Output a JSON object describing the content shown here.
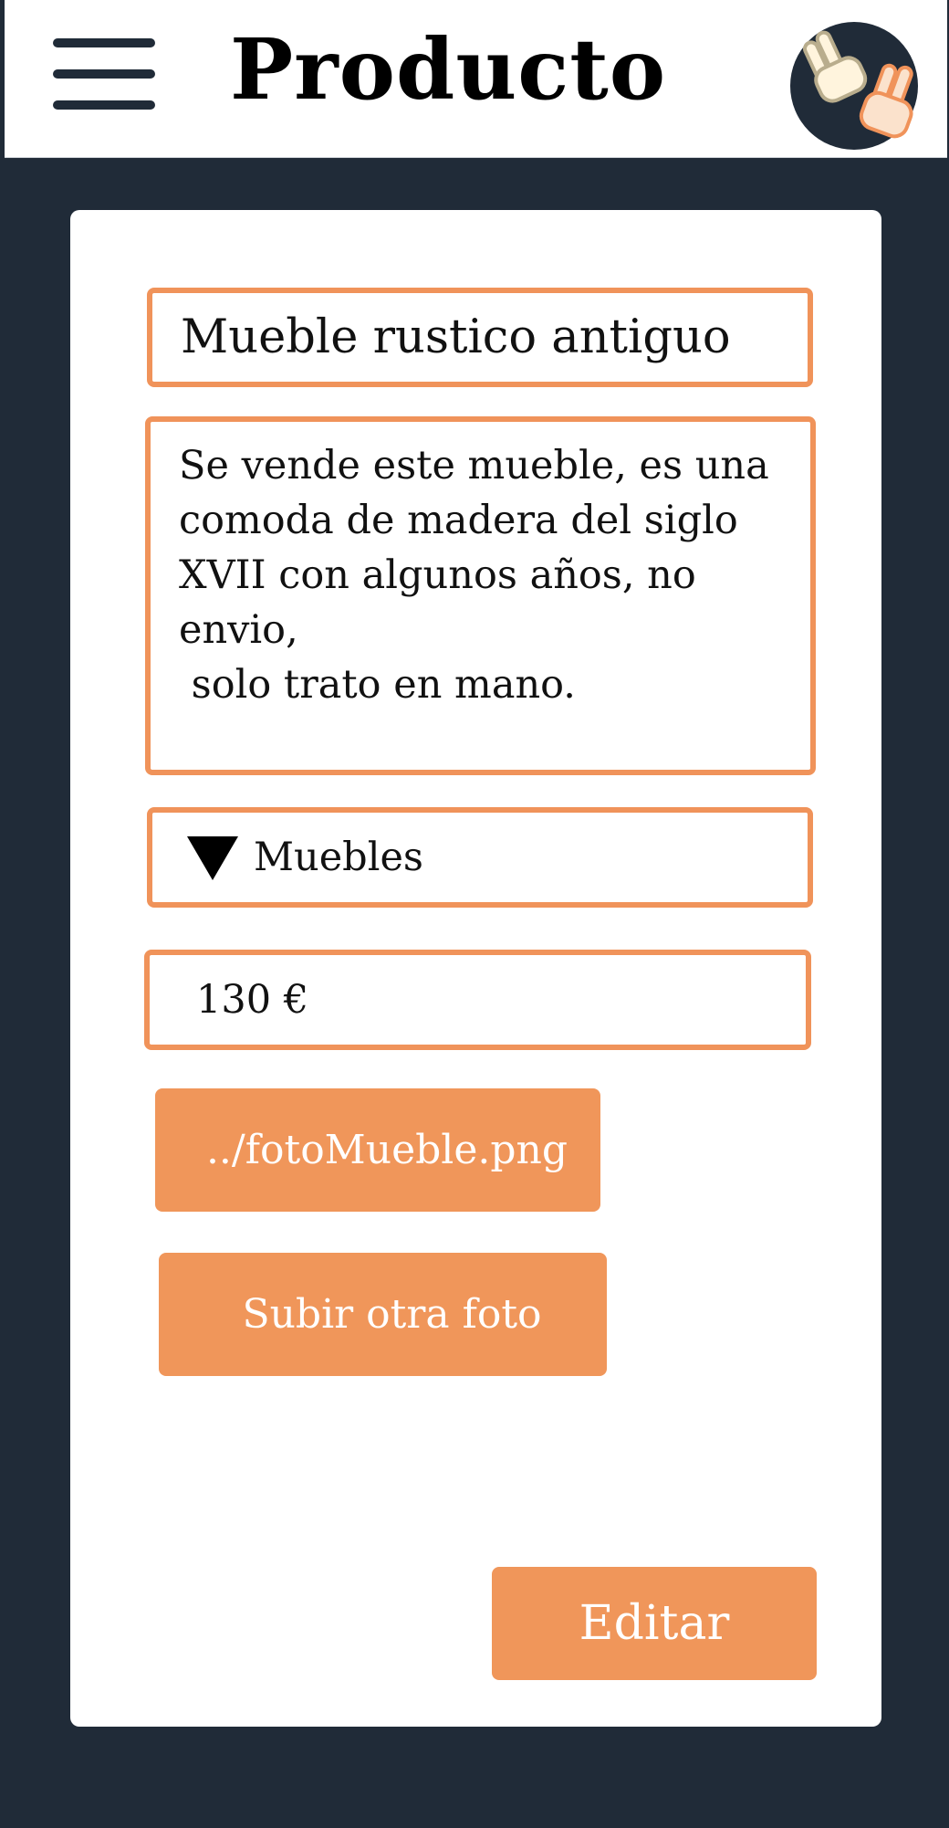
{
  "header": {
    "title": "Producto",
    "menu_icon": "hamburger-menu-icon",
    "logo_icon": "peace-hands-logo"
  },
  "form": {
    "product_name": "Mueble rustico antiguo",
    "description": "Se vende este mueble, es una\ncomoda de madera del siglo\nXVII con algunos años, no envio,\n solo trato en mano.",
    "category": "Muebles",
    "price": "130 €",
    "photo_file": "../fotoMueble.png",
    "upload_label": "Subir otra foto",
    "edit_label": "Editar"
  },
  "colors": {
    "accent": "#f0965a",
    "dark_background": "#202b38",
    "card_background": "#ffffff"
  }
}
